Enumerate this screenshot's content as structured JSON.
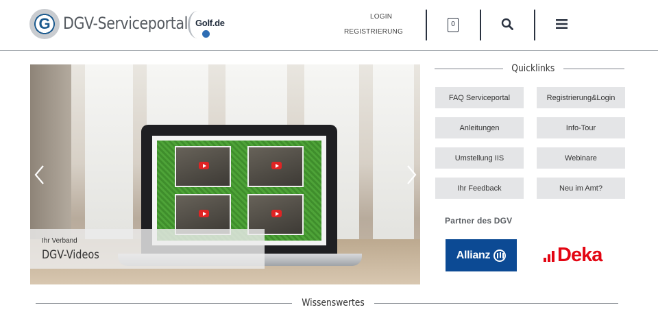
{
  "header": {
    "logo_letter": "G",
    "site_title": "DGV-Serviceportal",
    "partner_logo_text": "Golf.de",
    "login_link": "LOGIN",
    "register_link": "REGISTRIERUNG",
    "cart_count": "0",
    "icons": [
      "cart-icon",
      "search-icon",
      "menu-icon"
    ]
  },
  "slider": {
    "kicker": "Ihr Verband",
    "title": "DGV-Videos",
    "prev_icon": "chevron-left-icon",
    "next_icon": "chevron-right-icon"
  },
  "quicklinks": {
    "title": "Quicklinks",
    "items": [
      "FAQ Serviceportal",
      "Registrierung&Login",
      "Anleitungen",
      "Info-Tour",
      "Umstellung IIS",
      "Webinare",
      "Ihr Feedback",
      "Neu im Amt?"
    ]
  },
  "partners": {
    "title": "Partner des DGV",
    "allianz": "Allianz",
    "deka": "Deka"
  },
  "wissenswertes": {
    "title": "Wissenswertes"
  },
  "colors": {
    "brand_blue": "#1b5a8e",
    "button_bg": "#e4e5e7",
    "allianz_blue": "#0c4a94",
    "deka_red": "#e30613"
  }
}
